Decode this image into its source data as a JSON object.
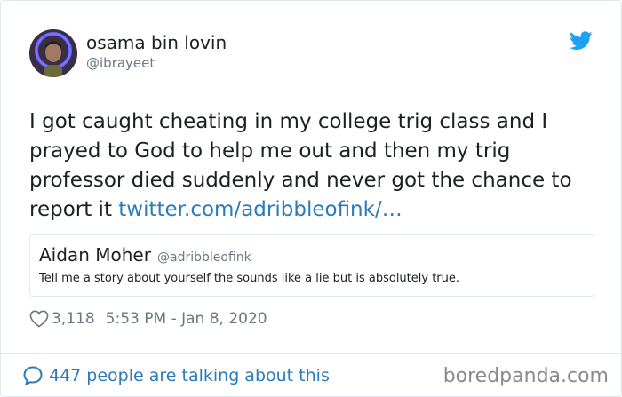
{
  "author": {
    "display_name": "osama bin lovin",
    "handle": "@ibrayeet",
    "avatar_icon": "person-with-ring-light-avatar"
  },
  "tweet": {
    "text": "I got caught cheating in my college trig class and I prayed to God to help me out and then my trig professor died suddenly and never got the chance to report it ",
    "link_text": "twitter.com/adribbleofink/…"
  },
  "quoted_tweet": {
    "display_name": "Aidan Moher",
    "handle": "@adribbleofink",
    "text": "Tell me a story about yourself the sounds like a lie but is absolutely true."
  },
  "meta": {
    "likes": "3,118",
    "timestamp": "5:53 PM - Jan 8, 2020"
  },
  "footer": {
    "talking_text": "447 people are talking about this"
  },
  "watermark": {
    "text": "boredpanda.com"
  },
  "icons": {
    "brand": "twitter-bird-icon",
    "like": "heart-icon",
    "reply": "speech-bubble-icon"
  },
  "colors": {
    "twitter_blue": "#1da1f2",
    "link_blue": "#2b7bb9",
    "text": "#1c2022",
    "muted": "#697882",
    "border": "#e1e8ed"
  }
}
